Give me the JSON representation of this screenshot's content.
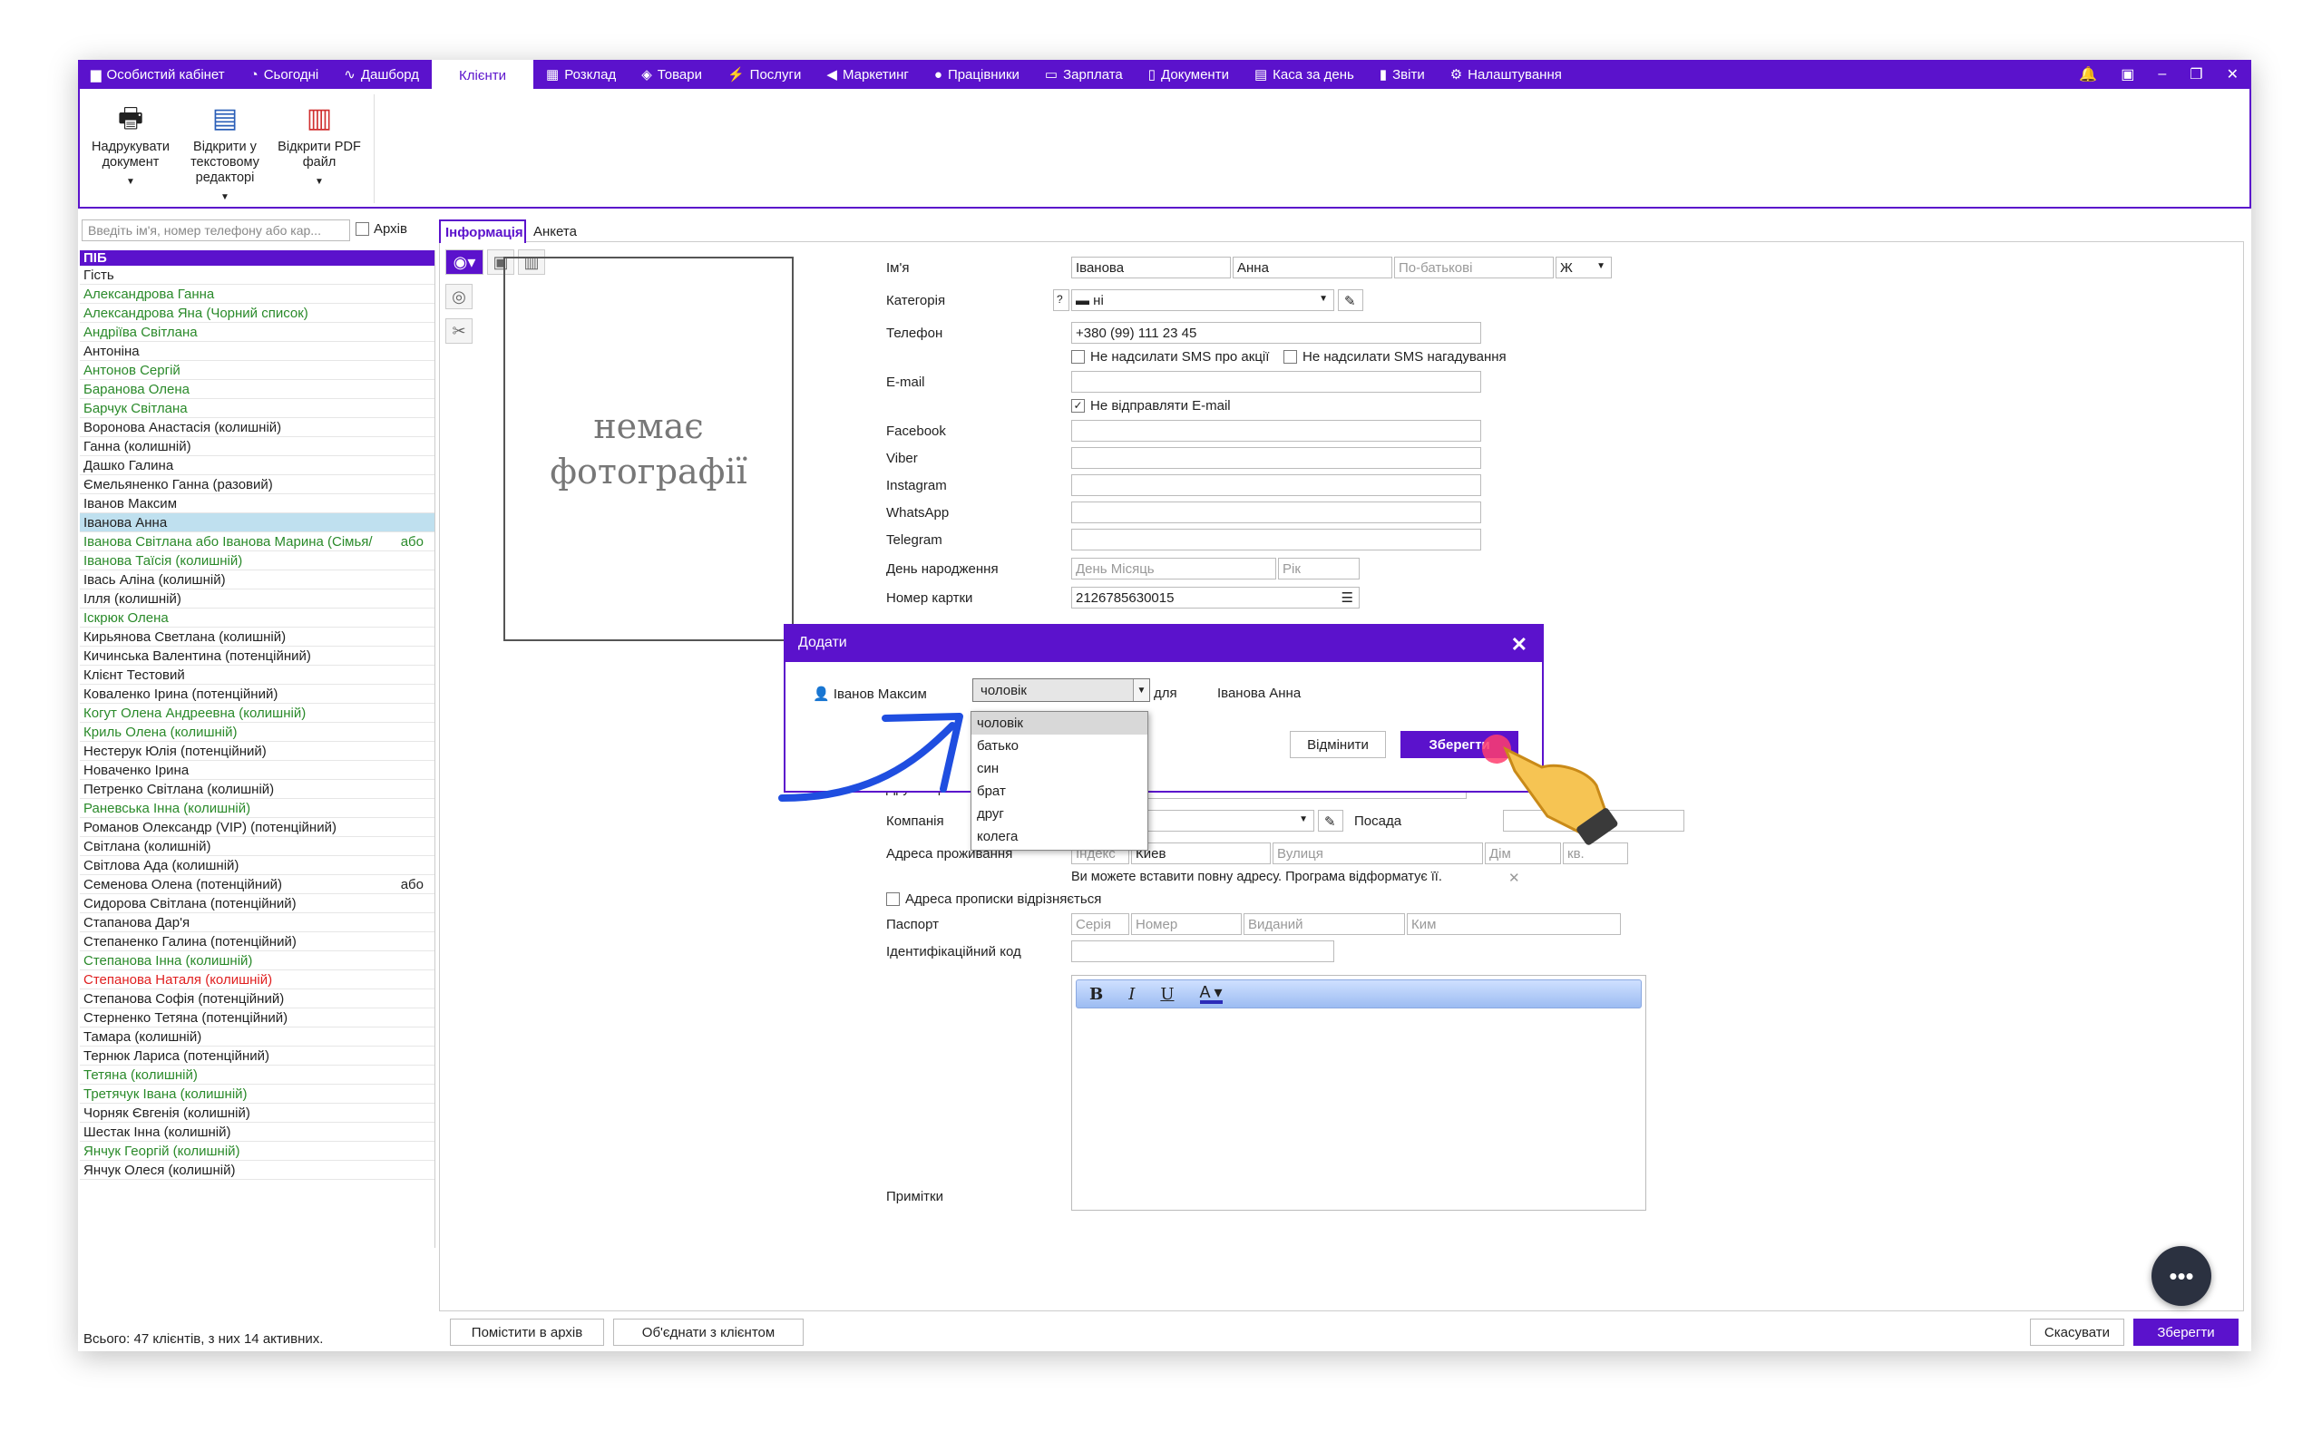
{
  "topnav": {
    "items": [
      {
        "icon": "briefcase-icon",
        "glyph": "▆",
        "label": "Особистий кабінет"
      },
      {
        "icon": "clock-icon",
        "glyph": "◔",
        "label": "Сьогодні"
      },
      {
        "icon": "dashboard-icon",
        "glyph": "∿",
        "label": "Дашборд"
      },
      {
        "icon": "",
        "glyph": "",
        "label": "Клієнти"
      },
      {
        "icon": "calendar-icon",
        "glyph": "▦",
        "label": "Розклад"
      },
      {
        "icon": "box-icon",
        "glyph": "◈",
        "label": "Товари"
      },
      {
        "icon": "bolt-icon",
        "glyph": "⚡",
        "label": "Послуги"
      },
      {
        "icon": "megaphone-icon",
        "glyph": "◀",
        "label": "Маркетинг"
      },
      {
        "icon": "user-icon",
        "glyph": "●",
        "label": "Працівники"
      },
      {
        "icon": "money-icon",
        "glyph": "▭",
        "label": "Зарплата"
      },
      {
        "icon": "document-icon",
        "glyph": "▯",
        "label": "Документи"
      },
      {
        "icon": "calculator-icon",
        "glyph": "▤",
        "label": "Каса за день"
      },
      {
        "icon": "bar-chart-icon",
        "glyph": "▮",
        "label": "Звіти"
      },
      {
        "icon": "gear-icon",
        "glyph": "⚙",
        "label": "Налаштування"
      }
    ],
    "active": "Клієнти"
  },
  "ribbon": {
    "print_label": "Надрукувати документ",
    "word_label": "Відкрити у текстовому редакторі",
    "pdf_label": "Відкрити PDF файл"
  },
  "left": {
    "search_placeholder": "Введіть ім'я, номер телефону або кар...",
    "archive_label": "Архів",
    "list_header": "ПІБ",
    "clients": [
      {
        "name": "Гість",
        "color": ""
      },
      {
        "name": "Александрова Ганна",
        "color": "green"
      },
      {
        "name": "Александрова Яна (Чорний список)",
        "color": "green"
      },
      {
        "name": "Андріїва Світлана",
        "color": "green"
      },
      {
        "name": "Антоніна",
        "color": ""
      },
      {
        "name": "Антонов Сергій",
        "color": "green"
      },
      {
        "name": "Баранова Олена",
        "color": "green"
      },
      {
        "name": "Барчук Світлана",
        "color": "green"
      },
      {
        "name": "Воронова Анастасія (колишній)",
        "color": ""
      },
      {
        "name": "Ганна (колишній)",
        "color": ""
      },
      {
        "name": "Дашко Галина",
        "color": ""
      },
      {
        "name": "Ємельяненко Ганна (разовий)",
        "color": ""
      },
      {
        "name": "Іванов Максим",
        "color": ""
      },
      {
        "name": "Іванова Анна",
        "color": "sel"
      },
      {
        "name": "Іванова Світлана або Іванова Марина (Сімья/",
        "color": "green",
        "suffix": "або"
      },
      {
        "name": "Іванова Таїсія (колишній)",
        "color": "green"
      },
      {
        "name": "Івась Аліна (колишній)",
        "color": ""
      },
      {
        "name": "Ілля (колишній)",
        "color": ""
      },
      {
        "name": "Іскрюк Олена",
        "color": "green"
      },
      {
        "name": "Кирьянова Светлана (колишній)",
        "color": ""
      },
      {
        "name": "Кичинська Валентина (потенційний)",
        "color": ""
      },
      {
        "name": "Клієнт Тестовий",
        "color": ""
      },
      {
        "name": "Коваленко Ірина (потенційний)",
        "color": ""
      },
      {
        "name": "Когут Олена Андреевна (колишній)",
        "color": "green"
      },
      {
        "name": "Криль Олена (колишній)",
        "color": "green"
      },
      {
        "name": "Нестерук Юлія (потенційний)",
        "color": ""
      },
      {
        "name": "Новаченко Ірина",
        "color": ""
      },
      {
        "name": "Петренко Світлана (колишній)",
        "color": ""
      },
      {
        "name": "Раневська Інна (колишній)",
        "color": "green"
      },
      {
        "name": "Романов Олександр (VIP) (потенційний)",
        "color": ""
      },
      {
        "name": "Світлана (колишній)",
        "color": ""
      },
      {
        "name": "Світлова Ада (колишній)",
        "color": ""
      },
      {
        "name": "Семенова Олена (потенційний)",
        "color": "",
        "suffix": "або"
      },
      {
        "name": "Сидорова Світлана (потенційний)",
        "color": ""
      },
      {
        "name": "Стапанова Дар'я",
        "color": ""
      },
      {
        "name": "Степаненко Галина (потенційний)",
        "color": ""
      },
      {
        "name": "Степанова Інна (колишній)",
        "color": "green"
      },
      {
        "name": "Степанова Наталя (колишній)",
        "color": "red"
      },
      {
        "name": "Степанова Софія (потенційний)",
        "color": ""
      },
      {
        "name": "Стерненко Тетяна (потенційний)",
        "color": ""
      },
      {
        "name": "Тамара (колишній)",
        "color": ""
      },
      {
        "name": "Тернюк Лариса (потенційний)",
        "color": ""
      },
      {
        "name": "Тетяна (колишній)",
        "color": "green"
      },
      {
        "name": "Третячук Івана (колишній)",
        "color": "green"
      },
      {
        "name": "Чорняк Євгенія (колишній)",
        "color": ""
      },
      {
        "name": "Шестак Інна (колишній)",
        "color": ""
      },
      {
        "name": "Янчук Георгій (колишній)",
        "color": "green"
      },
      {
        "name": "Янчук Олеся (колишній)",
        "color": ""
      }
    ],
    "total": "Всього: 47 клієнтів, з них 14 активних."
  },
  "tabs": {
    "info": "Інформація",
    "anketa": "Анкета"
  },
  "photo": {
    "line1": "немає",
    "line2": "фотографії"
  },
  "form": {
    "name_label": "Ім'я",
    "surname_value": "Іванова",
    "firstname_value": "Анна",
    "patronymic_placeholder": "По-батькові",
    "gender_value": "Ж",
    "category_label": "Категорія",
    "category_help": "?",
    "category_value": "ні",
    "phone_label": "Телефон",
    "phone_value": "+380 (99) 111 23 45",
    "no_sms_promo": "Не надсилати SMS про акції",
    "no_sms_remind": "Не надсилати SMS нагадування",
    "email_label": "E-mail",
    "no_email": "Не відправляти E-mail",
    "facebook_label": "Facebook",
    "viber_label": "Viber",
    "instagram_label": "Instagram",
    "whatsapp_label": "WhatsApp",
    "telegram_label": "Telegram",
    "birthday_label": "День народження",
    "birthday_placeholder": "День Місяць",
    "year_placeholder": "Рік",
    "card_label": "Номер картки",
    "card_value": "2126785630015",
    "second_spec_label": "Другий фахівець",
    "company_label": "Компанія",
    "position_label": "Посада",
    "address_label": "Адреса проживання",
    "index_placeholder": "Індекс",
    "city_value": "Киев",
    "street_placeholder": "Вулиця",
    "house_placeholder": "Дім",
    "apt_placeholder": "кв.",
    "address_hint": "Ви можете вставити повну адресу. Програма відформатує її.",
    "address_reg_diff": "Адреса прописки відрізняється",
    "passport_label": "Паспорт",
    "series_placeholder": "Серія",
    "number_placeholder": "Номер",
    "issued_placeholder": "Виданий",
    "by_whom_placeholder": "Ким",
    "id_code_label": "Ідентифікаційний код",
    "notes_label": "Примітки"
  },
  "dialog": {
    "title": "Додати",
    "person": "Іванов Максим",
    "relation_value": "чоловік",
    "for_label": "для",
    "target": "Іванова Анна",
    "cancel_label": "Відмінити",
    "save_label": "Зберегти",
    "options": [
      "чоловік",
      "батько",
      "син",
      "брат",
      "друг",
      "колега"
    ]
  },
  "bottom": {
    "archive_btn": "Помістити в архів",
    "merge_btn": "Об'єднати з клієнтом",
    "cancel_btn": "Скасувати",
    "save_btn": "Зберегти"
  },
  "colors": {
    "accent": "#5b12cc",
    "green": "#2a8a2a",
    "red": "#e02020",
    "selected": "#bfe0ef"
  }
}
